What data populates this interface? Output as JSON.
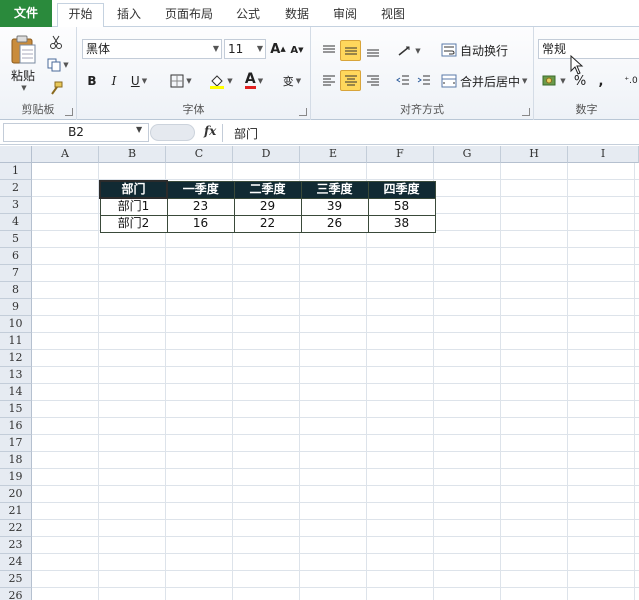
{
  "tabs": [
    {
      "label": "文件"
    },
    {
      "label": "开始"
    },
    {
      "label": "插入"
    },
    {
      "label": "页面布局"
    },
    {
      "label": "公式"
    },
    {
      "label": "数据"
    },
    {
      "label": "审阅"
    },
    {
      "label": "视图"
    }
  ],
  "ribbon": {
    "clipboard": {
      "label": "剪贴板",
      "paste_label": "粘贴"
    },
    "font": {
      "label": "字体",
      "font_name": "黑体",
      "font_size": "11",
      "bold": "B",
      "italic": "I",
      "underline": "U",
      "grow": "A",
      "shrink": "A",
      "font_color": "A",
      "phonetic": "变"
    },
    "alignment": {
      "label": "对齐方式",
      "wrap_text": "自动换行",
      "merge_center": "合并后居中"
    },
    "number": {
      "label": "数字",
      "format": "常规",
      "percent": "%",
      "comma": ","
    }
  },
  "formula_bar": {
    "name_box": "B2",
    "fx": "fx",
    "value": "部门"
  },
  "columns": [
    "A",
    "B",
    "C",
    "D",
    "E",
    "F",
    "G",
    "H",
    "I"
  ],
  "rows": [
    "1",
    "2",
    "3",
    "4",
    "5",
    "6",
    "7",
    "8",
    "9",
    "10",
    "11",
    "12",
    "13",
    "14",
    "15",
    "16",
    "17",
    "18",
    "19",
    "20",
    "21",
    "22",
    "23",
    "24",
    "25",
    "26"
  ],
  "table": {
    "header": [
      "部门",
      "一季度",
      "二季度",
      "三季度",
      "四季度"
    ],
    "rows": [
      [
        "部门1",
        "23",
        "29",
        "39",
        "58"
      ],
      [
        "部门2",
        "16",
        "22",
        "26",
        "38"
      ]
    ]
  },
  "colors": {
    "file_tab": "#2a8a3c",
    "table_header": "#112a33",
    "pressed": "#ffd75c"
  }
}
